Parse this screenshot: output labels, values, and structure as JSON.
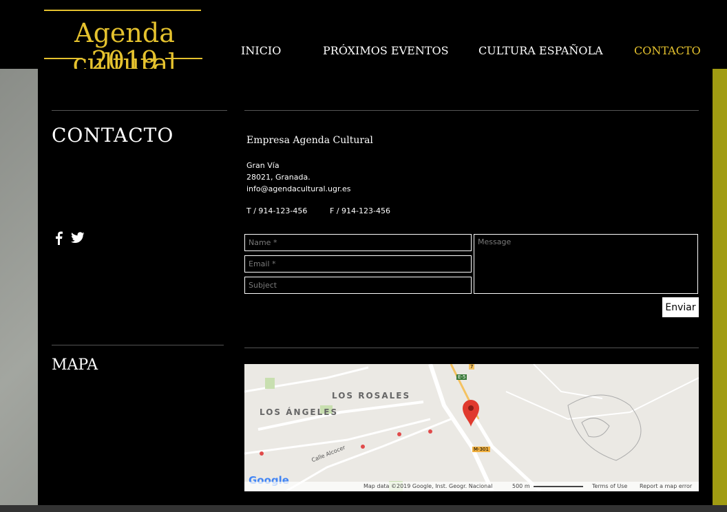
{
  "brand": {
    "title": "Agenda cultural",
    "year": "2019",
    "color": "#e5c22e"
  },
  "nav": {
    "items": [
      {
        "label": "INICIO"
      },
      {
        "label": "PRÓXIMOS EVENTOS"
      },
      {
        "label": "CULTURA ESPAÑOLA"
      },
      {
        "label": "CONTACTO",
        "active": true
      }
    ]
  },
  "contact": {
    "heading": "CONTACTO",
    "company": "Empresa Agenda Cultural",
    "street": "Gran Vía",
    "city": "28021, Granada.",
    "email": "info@agendacultural.ugr.es",
    "phone": "T  /  914-123-456",
    "fax": "F  /  914-123-456"
  },
  "social": {
    "icons": [
      "facebook-icon",
      "twitter-icon"
    ]
  },
  "form": {
    "name_placeholder": "Name *",
    "email_placeholder": "Email *",
    "subject_placeholder": "Subject",
    "message_placeholder": "Message",
    "send_label": "Enviar"
  },
  "map": {
    "heading": "MAPA",
    "labels": {
      "rosales": "LOS ROSALES",
      "angeles": "LOS ÁNGELES",
      "calle": "Calle Alcocer",
      "e5": "E-5",
      "m301": "M-301",
      "seven": "7",
      "logo": "Google"
    },
    "attribution": "Map data ©2019 Google, Inst. Geogr. Nacional",
    "scale": "500 m",
    "terms": "Terms of Use",
    "report": "Report a map error"
  }
}
